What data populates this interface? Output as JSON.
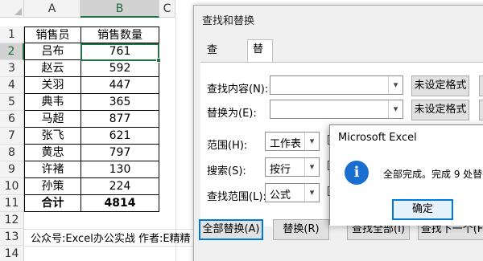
{
  "sheet": {
    "columns": [
      "A",
      "B",
      "C"
    ],
    "rows": [
      "1",
      "2",
      "3",
      "4",
      "5",
      "6",
      "7",
      "8",
      "9",
      "10",
      "11",
      "12",
      "13",
      "14"
    ],
    "header": [
      "销售员",
      "销售数量"
    ],
    "data": [
      [
        "吕布",
        "761"
      ],
      [
        "赵云",
        "592"
      ],
      [
        "关羽",
        "447"
      ],
      [
        "典韦",
        "365"
      ],
      [
        "马超",
        "877"
      ],
      [
        "张飞",
        "621"
      ],
      [
        "黄忠",
        "797"
      ],
      [
        "许褚",
        "130"
      ],
      [
        "孙策",
        "224"
      ]
    ],
    "total": [
      "合计",
      "4814"
    ],
    "note": "公众号:Excel办公实战  作者:E精精"
  },
  "find_replace": {
    "title": "查找和替换",
    "tabs": [
      "查找(D)",
      "替换(P)"
    ],
    "find_label": "查找内容(N):",
    "replace_label": "替换为(E):",
    "format_button": "未设定格式",
    "scope_label": "范围(H):",
    "scope_value": "工作表",
    "search_label": "搜索(S):",
    "search_value": "按行",
    "lookin_label": "查找范围(L):",
    "lookin_value": "公式",
    "replace_all_button": "全部替换(A)",
    "replace_button": "替换(R)",
    "find_all_button": "查找全部(I)",
    "find_next_button": "查找下一个(F)"
  },
  "message": {
    "title": "Microsoft Excel",
    "text": "全部完成。完成 9 处替换。",
    "ok_button": "确定"
  }
}
